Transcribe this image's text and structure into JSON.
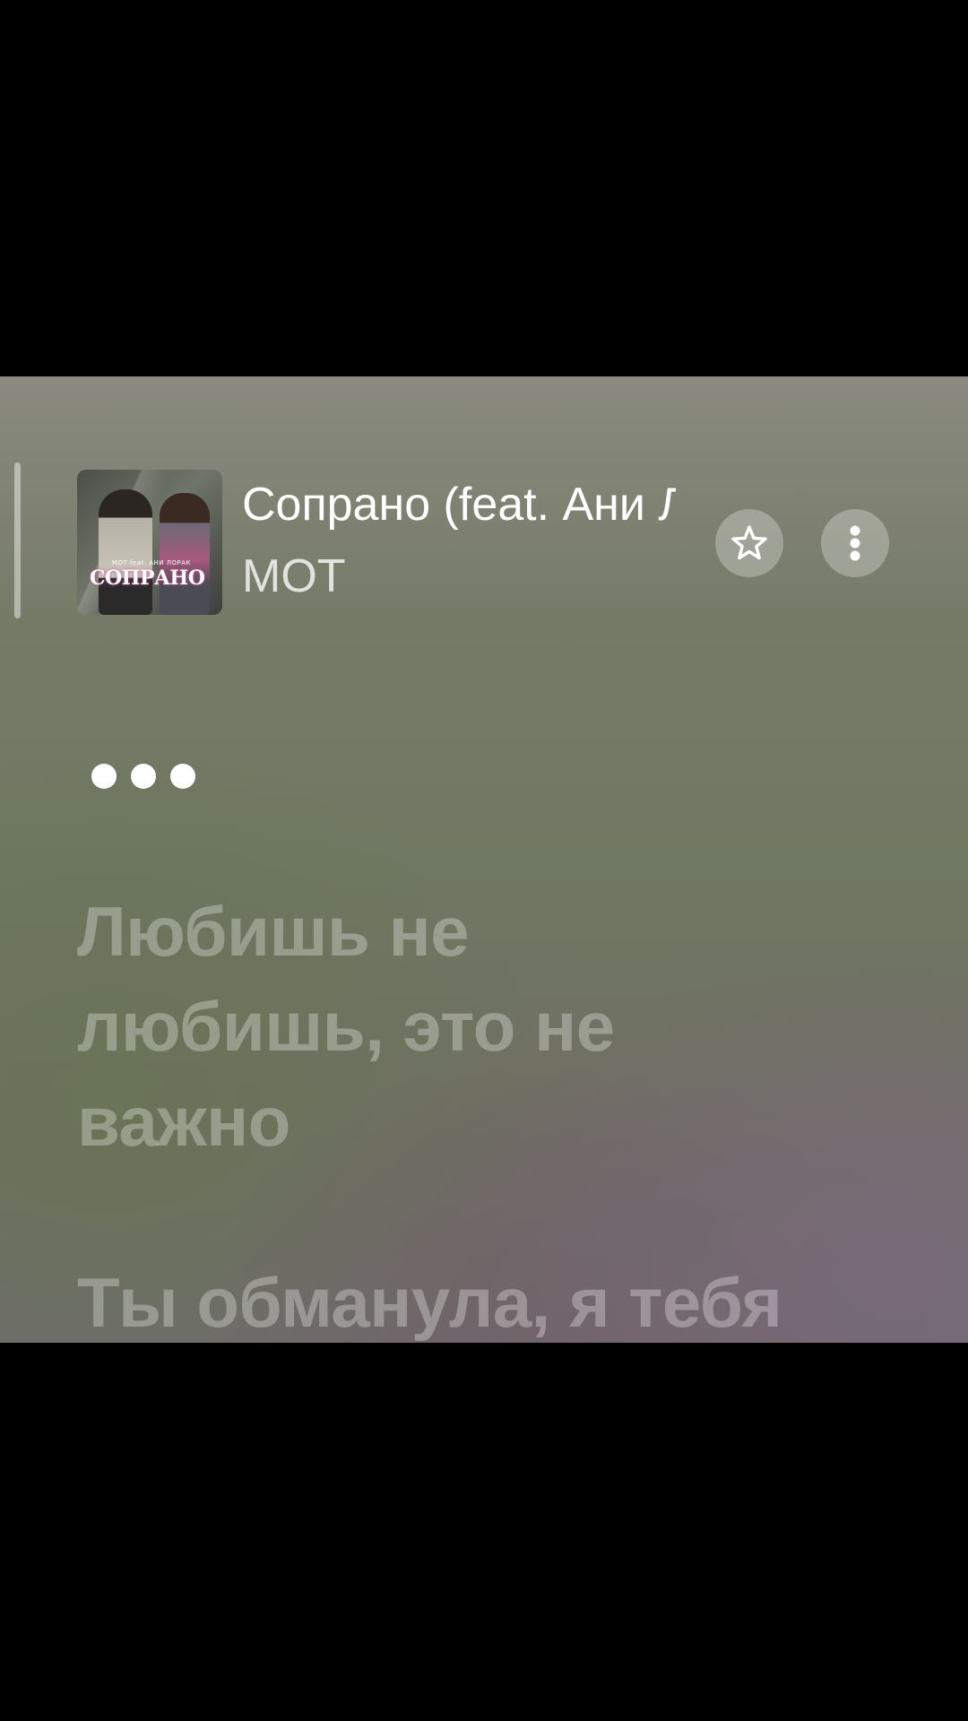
{
  "track": {
    "title": "Сопрано (feat. Ани Лорак)",
    "artist": "МОТ"
  },
  "album_art": {
    "small_text": "МОТ feat. АНИ ЛОРАК",
    "title": "СОПРАНО"
  },
  "buttons": {
    "favorite_icon": "star-outline-icon",
    "more_icon": "vertical-ellipsis-icon"
  },
  "lyrics": [
    "Любишь не любишь, это не важно",
    "Ты обманула, я тебя"
  ],
  "colors": {
    "lyric_inactive": "rgba(255,255,255,0.30)",
    "text_primary": "#ffffff"
  }
}
